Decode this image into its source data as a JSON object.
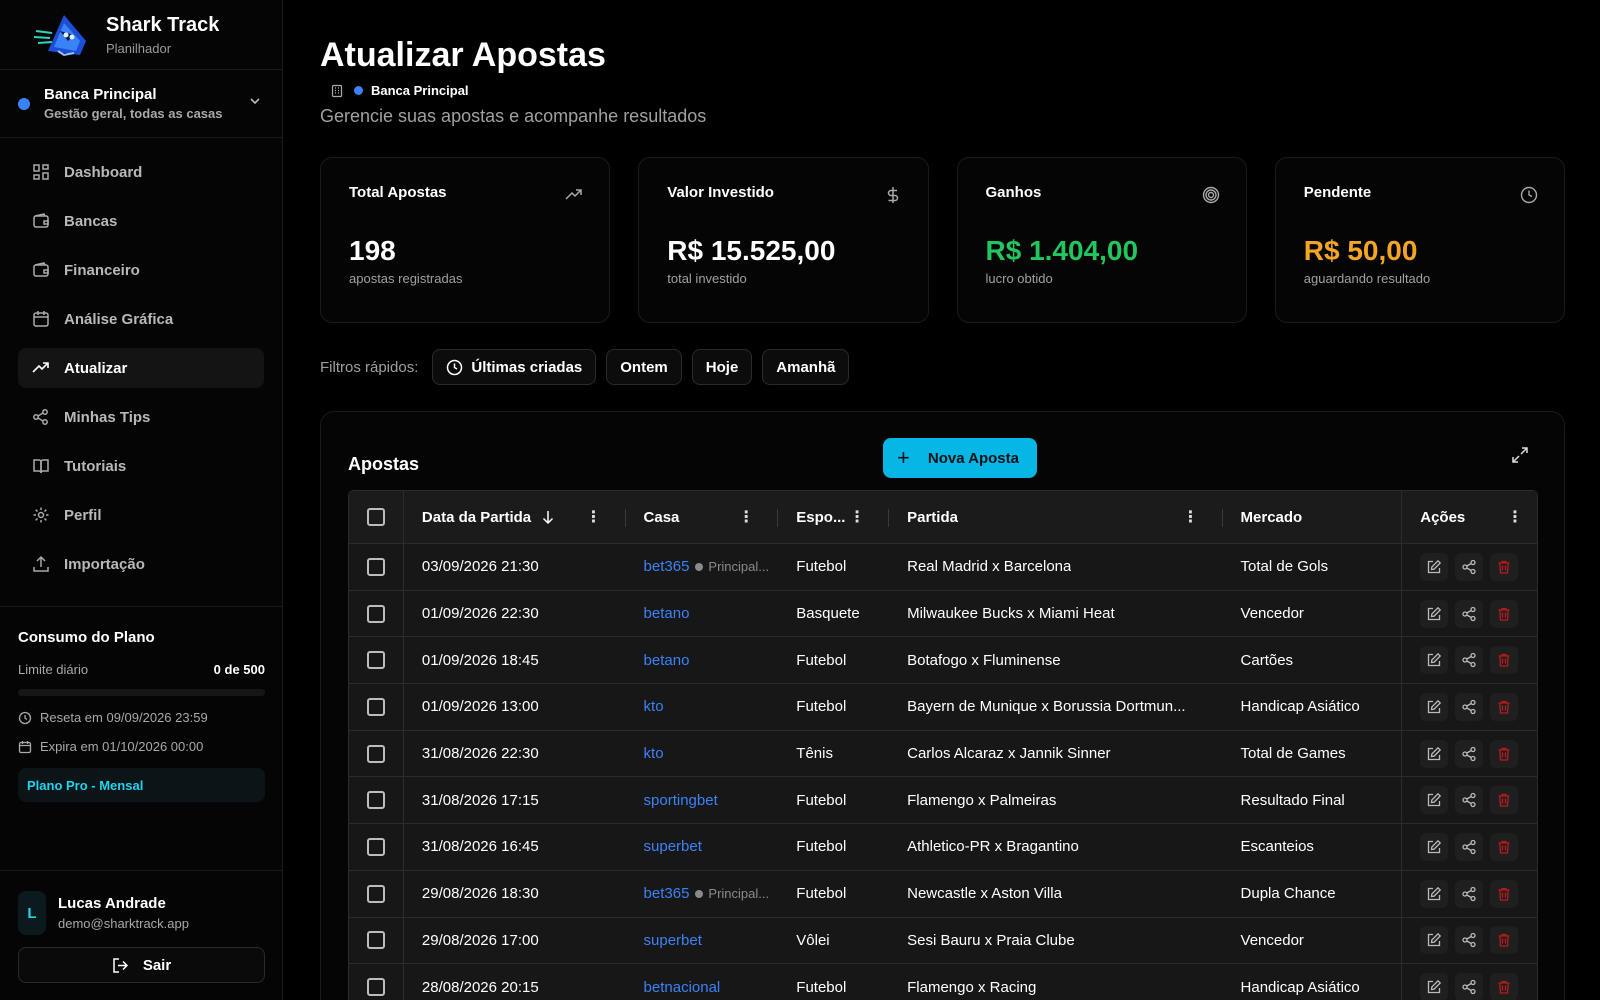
{
  "brand": {
    "title": "Shark Track",
    "subtitle": "Planilhador"
  },
  "bank_selector": {
    "name": "Banca Principal",
    "description": "Gestão geral, todas as casas",
    "color": "#3b82f6"
  },
  "nav": {
    "items": [
      {
        "label": "Dashboard",
        "icon": "grid-icon"
      },
      {
        "label": "Bancas",
        "icon": "wallet-icon"
      },
      {
        "label": "Financeiro",
        "icon": "wallet-icon"
      },
      {
        "label": "Análise Gráfica",
        "icon": "calendar-icon"
      },
      {
        "label": "Atualizar",
        "icon": "trending-up-icon",
        "active": true
      },
      {
        "label": "Minhas Tips",
        "icon": "share-icon"
      },
      {
        "label": "Tutoriais",
        "icon": "book-icon"
      },
      {
        "label": "Perfil",
        "icon": "gear-icon"
      },
      {
        "label": "Importação",
        "icon": "upload-icon"
      }
    ]
  },
  "plan": {
    "title": "Consumo do Plano",
    "limit_label": "Limite diário",
    "limit_value": "0 de 500",
    "usage_fraction": 0,
    "reset": "Reseta em 09/09/2026 23:59",
    "expires": "Expira em 01/10/2026 00:00",
    "badge": "Plano Pro - Mensal"
  },
  "user": {
    "initial": "L",
    "name": "Lucas Andrade",
    "email": "demo@sharktrack.app",
    "logout_label": "Sair"
  },
  "header": {
    "title": "Atualizar Apostas",
    "crumb": "Banca Principal",
    "subtitle": "Gerencie suas apostas e acompanhe resultados"
  },
  "cards": [
    {
      "title": "Total Apostas",
      "value": "198",
      "note": "apostas registradas",
      "icon": "trending-up-icon"
    },
    {
      "title": "Valor Investido",
      "value": "R$ 15.525,00",
      "note": "total investido",
      "icon": "dollar-icon"
    },
    {
      "title": "Ganhos",
      "value": "R$ 1.404,00",
      "note": "lucro obtido",
      "icon": "target-icon",
      "color": "#22c55e"
    },
    {
      "title": "Pendente",
      "value": "R$ 50,00",
      "note": "aguardando resultado",
      "icon": "clock-icon",
      "color": "#f5a524"
    }
  ],
  "filters": {
    "label": "Filtros rápidos:",
    "chips": [
      "Últimas criadas",
      "Ontem",
      "Hoje",
      "Amanhã"
    ]
  },
  "bets": {
    "title": "Apostas",
    "new_label": "Nova Aposta",
    "columns": {
      "date": "Data da Partida",
      "casa": "Casa",
      "esporte": "Espo...",
      "partida": "Partida",
      "mercado": "Mercado",
      "acoes": "Ações"
    },
    "rows": [
      {
        "date": "03/09/2026 21:30",
        "casa": "bet365",
        "tag": "Principal...",
        "esporte": "Futebol",
        "partida": "Real Madrid x Barcelona",
        "mercado": "Total de Gols"
      },
      {
        "date": "01/09/2026 22:30",
        "casa": "betano",
        "tag": "",
        "esporte": "Basquete",
        "partida": "Milwaukee Bucks x Miami Heat",
        "mercado": "Vencedor"
      },
      {
        "date": "01/09/2026 18:45",
        "casa": "betano",
        "tag": "",
        "esporte": "Futebol",
        "partida": "Botafogo x Fluminense",
        "mercado": "Cartões"
      },
      {
        "date": "01/09/2026 13:00",
        "casa": "kto",
        "tag": "",
        "esporte": "Futebol",
        "partida": "Bayern de Munique x Borussia Dortmun...",
        "mercado": "Handicap Asiático"
      },
      {
        "date": "31/08/2026 22:30",
        "casa": "kto",
        "tag": "",
        "esporte": "Tênis",
        "partida": "Carlos Alcaraz x Jannik Sinner",
        "mercado": "Total de Games"
      },
      {
        "date": "31/08/2026 17:15",
        "casa": "sportingbet",
        "tag": "",
        "esporte": "Futebol",
        "partida": "Flamengo x Palmeiras",
        "mercado": "Resultado Final"
      },
      {
        "date": "31/08/2026 16:45",
        "casa": "superbet",
        "tag": "",
        "esporte": "Futebol",
        "partida": "Athletico-PR x Bragantino",
        "mercado": "Escanteios"
      },
      {
        "date": "29/08/2026 18:30",
        "casa": "bet365",
        "tag": "Principal...",
        "esporte": "Futebol",
        "partida": "Newcastle x Aston Villa",
        "mercado": "Dupla Chance"
      },
      {
        "date": "29/08/2026 17:00",
        "casa": "superbet",
        "tag": "",
        "esporte": "Vôlei",
        "partida": "Sesi Bauru x Praia Clube",
        "mercado": "Vencedor"
      },
      {
        "date": "28/08/2026 20:15",
        "casa": "betnacional",
        "tag": "",
        "esporte": "Futebol",
        "partida": "Flamengo x Racing",
        "mercado": "Handicap Asiático"
      }
    ]
  },
  "colors": {
    "accent": "#06b6e4",
    "link": "#3b82f6",
    "green": "#22c55e",
    "orange": "#f5a524",
    "danger": "#dc2626"
  }
}
